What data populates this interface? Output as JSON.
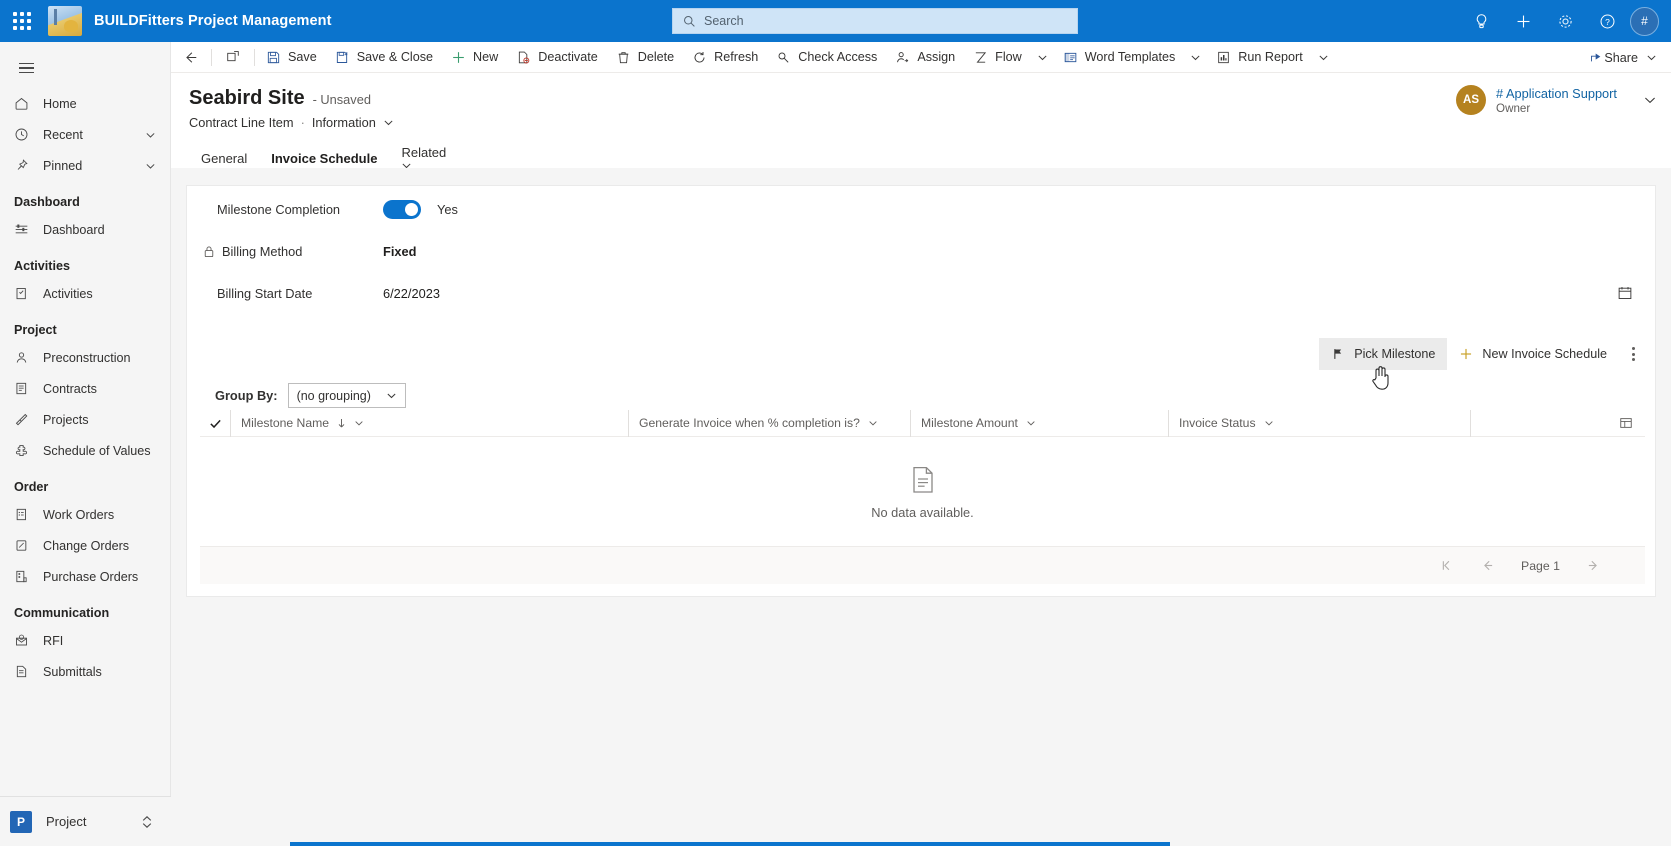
{
  "appbar": {
    "waffle_label": "App launcher",
    "app_title": "BUILDFitters Project Management",
    "search_placeholder": "Search",
    "search_value": "",
    "icons": [
      "lightbulb-icon",
      "plus-icon",
      "gear-icon",
      "help-icon"
    ],
    "avatar_initials": "#"
  },
  "sidebar": {
    "items": [
      {
        "label": "Home",
        "icon": "home-icon",
        "expandable": false
      },
      {
        "label": "Recent",
        "icon": "clock-icon",
        "expandable": true
      },
      {
        "label": "Pinned",
        "icon": "pin-icon",
        "expandable": true
      }
    ],
    "groups": [
      {
        "title": "Dashboard",
        "items": [
          {
            "label": "Dashboard",
            "icon": "dashboard-icon"
          }
        ]
      },
      {
        "title": "Activities",
        "items": [
          {
            "label": "Activities",
            "icon": "clipboard-icon"
          }
        ]
      },
      {
        "title": "Project",
        "items": [
          {
            "label": "Preconstruction",
            "icon": "person-icon"
          },
          {
            "label": "Contracts",
            "icon": "contract-icon"
          },
          {
            "label": "Projects",
            "icon": "projects-icon"
          },
          {
            "label": "Schedule of Values",
            "icon": "puzzle-icon"
          }
        ]
      },
      {
        "title": "Order",
        "items": [
          {
            "label": "Work Orders",
            "icon": "work-order-icon"
          },
          {
            "label": "Change Orders",
            "icon": "change-order-icon"
          },
          {
            "label": "Purchase Orders",
            "icon": "purchase-order-icon"
          }
        ]
      },
      {
        "title": "Communication",
        "items": [
          {
            "label": "RFI",
            "icon": "rfi-icon"
          },
          {
            "label": "Submittals",
            "icon": "submittals-icon"
          }
        ]
      }
    ],
    "footer": {
      "badge": "P",
      "label": "Project",
      "icon": "area-switcher-icon"
    }
  },
  "commandbar": {
    "back_icon": "back-arrow-icon",
    "popout_icon": "popout-icon",
    "buttons": [
      {
        "label": "Save",
        "icon": "save-icon"
      },
      {
        "label": "Save & Close",
        "icon": "save-close-icon"
      },
      {
        "label": "New",
        "icon": "plus-icon"
      },
      {
        "label": "Deactivate",
        "icon": "deactivate-icon"
      },
      {
        "label": "Delete",
        "icon": "trash-icon"
      },
      {
        "label": "Refresh",
        "icon": "refresh-icon"
      },
      {
        "label": "Check Access",
        "icon": "key-icon"
      },
      {
        "label": "Assign",
        "icon": "assign-icon"
      },
      {
        "label": "Flow",
        "icon": "flow-icon",
        "caret": true
      },
      {
        "label": "Word Templates",
        "icon": "word-template-icon",
        "caret": true
      },
      {
        "label": "Run Report",
        "icon": "report-icon",
        "caret": true
      }
    ],
    "share": {
      "label": "Share",
      "icon": "share-icon",
      "caret": true
    }
  },
  "record": {
    "name": "Seabird Site",
    "unsaved": "- Unsaved",
    "entity": "Contract Line Item",
    "separator": "·",
    "form": "Information",
    "tabs": [
      {
        "label": "General",
        "active": false,
        "caret": false
      },
      {
        "label": "Invoice Schedule",
        "active": true,
        "caret": false
      },
      {
        "label": "Related",
        "active": false,
        "caret": true
      }
    ],
    "owner": {
      "initials": "AS",
      "name": "# Application Support",
      "role": "Owner"
    }
  },
  "form": {
    "fields": [
      {
        "label": "Milestone Completion",
        "type": "toggle",
        "value": "Yes",
        "on": true,
        "locked": false
      },
      {
        "label": "Billing Method",
        "type": "text",
        "value": "Fixed",
        "locked": true
      },
      {
        "label": "Billing Start Date",
        "type": "date",
        "value": "6/22/2023",
        "locked": false
      }
    ],
    "calendar_icon": "calendar-icon"
  },
  "subgrid": {
    "commands": [
      {
        "label": "Pick Milestone",
        "icon": "milestone-flag-icon",
        "hover": true
      },
      {
        "label": "New Invoice Schedule",
        "icon": "plus-icon",
        "hover": false
      }
    ],
    "overflow_icon": "more-commands-icon",
    "groupby": {
      "label": "Group By:",
      "selected": "(no grouping)",
      "chevron_icon": "chevron-down-icon"
    },
    "columns": [
      {
        "label": "Milestone Name",
        "sorted": "ascending",
        "sort_icon": "sort-down-arrow-icon"
      },
      {
        "label": "Generate Invoice when % completion is?",
        "sorted": "",
        "sort_icon": ""
      },
      {
        "label": "Milestone Amount",
        "sorted": "",
        "sort_icon": ""
      },
      {
        "label": "Invoice Status",
        "sorted": "",
        "sort_icon": ""
      }
    ],
    "select_all_icon": "checkmark-icon",
    "column_chooser_icon": "column-options-icon",
    "empty_state": {
      "icon": "document-icon",
      "text": "No data available."
    },
    "pager": {
      "first_icon": "page-first-icon",
      "prev_icon": "page-previous-icon",
      "label": "Page 1",
      "next_icon": "page-next-icon"
    }
  }
}
